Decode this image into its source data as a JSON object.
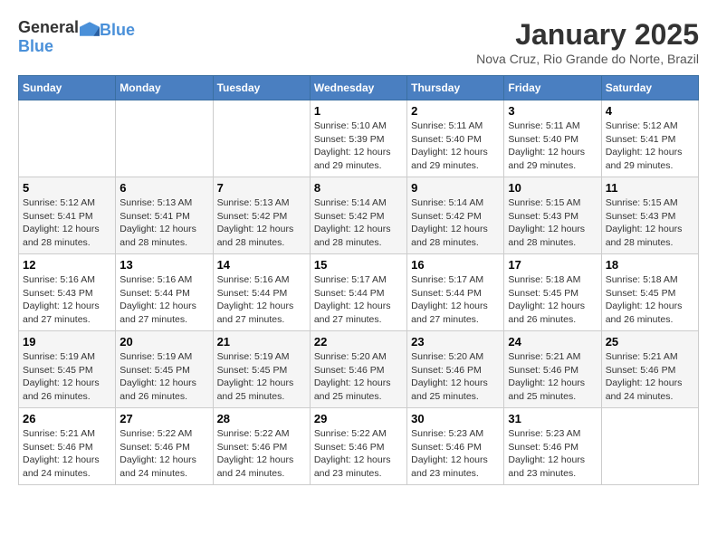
{
  "header": {
    "logo": {
      "general": "General",
      "blue": "Blue"
    },
    "title": "January 2025",
    "subtitle": "Nova Cruz, Rio Grande do Norte, Brazil"
  },
  "calendar": {
    "weekdays": [
      "Sunday",
      "Monday",
      "Tuesday",
      "Wednesday",
      "Thursday",
      "Friday",
      "Saturday"
    ],
    "weeks": [
      [
        {
          "day": "",
          "info": ""
        },
        {
          "day": "",
          "info": ""
        },
        {
          "day": "",
          "info": ""
        },
        {
          "day": "1",
          "info": "Sunrise: 5:10 AM\nSunset: 5:39 PM\nDaylight: 12 hours\nand 29 minutes."
        },
        {
          "day": "2",
          "info": "Sunrise: 5:11 AM\nSunset: 5:40 PM\nDaylight: 12 hours\nand 29 minutes."
        },
        {
          "day": "3",
          "info": "Sunrise: 5:11 AM\nSunset: 5:40 PM\nDaylight: 12 hours\nand 29 minutes."
        },
        {
          "day": "4",
          "info": "Sunrise: 5:12 AM\nSunset: 5:41 PM\nDaylight: 12 hours\nand 29 minutes."
        }
      ],
      [
        {
          "day": "5",
          "info": "Sunrise: 5:12 AM\nSunset: 5:41 PM\nDaylight: 12 hours\nand 28 minutes."
        },
        {
          "day": "6",
          "info": "Sunrise: 5:13 AM\nSunset: 5:41 PM\nDaylight: 12 hours\nand 28 minutes."
        },
        {
          "day": "7",
          "info": "Sunrise: 5:13 AM\nSunset: 5:42 PM\nDaylight: 12 hours\nand 28 minutes."
        },
        {
          "day": "8",
          "info": "Sunrise: 5:14 AM\nSunset: 5:42 PM\nDaylight: 12 hours\nand 28 minutes."
        },
        {
          "day": "9",
          "info": "Sunrise: 5:14 AM\nSunset: 5:42 PM\nDaylight: 12 hours\nand 28 minutes."
        },
        {
          "day": "10",
          "info": "Sunrise: 5:15 AM\nSunset: 5:43 PM\nDaylight: 12 hours\nand 28 minutes."
        },
        {
          "day": "11",
          "info": "Sunrise: 5:15 AM\nSunset: 5:43 PM\nDaylight: 12 hours\nand 28 minutes."
        }
      ],
      [
        {
          "day": "12",
          "info": "Sunrise: 5:16 AM\nSunset: 5:43 PM\nDaylight: 12 hours\nand 27 minutes."
        },
        {
          "day": "13",
          "info": "Sunrise: 5:16 AM\nSunset: 5:44 PM\nDaylight: 12 hours\nand 27 minutes."
        },
        {
          "day": "14",
          "info": "Sunrise: 5:16 AM\nSunset: 5:44 PM\nDaylight: 12 hours\nand 27 minutes."
        },
        {
          "day": "15",
          "info": "Sunrise: 5:17 AM\nSunset: 5:44 PM\nDaylight: 12 hours\nand 27 minutes."
        },
        {
          "day": "16",
          "info": "Sunrise: 5:17 AM\nSunset: 5:44 PM\nDaylight: 12 hours\nand 27 minutes."
        },
        {
          "day": "17",
          "info": "Sunrise: 5:18 AM\nSunset: 5:45 PM\nDaylight: 12 hours\nand 26 minutes."
        },
        {
          "day": "18",
          "info": "Sunrise: 5:18 AM\nSunset: 5:45 PM\nDaylight: 12 hours\nand 26 minutes."
        }
      ],
      [
        {
          "day": "19",
          "info": "Sunrise: 5:19 AM\nSunset: 5:45 PM\nDaylight: 12 hours\nand 26 minutes."
        },
        {
          "day": "20",
          "info": "Sunrise: 5:19 AM\nSunset: 5:45 PM\nDaylight: 12 hours\nand 26 minutes."
        },
        {
          "day": "21",
          "info": "Sunrise: 5:19 AM\nSunset: 5:45 PM\nDaylight: 12 hours\nand 25 minutes."
        },
        {
          "day": "22",
          "info": "Sunrise: 5:20 AM\nSunset: 5:46 PM\nDaylight: 12 hours\nand 25 minutes."
        },
        {
          "day": "23",
          "info": "Sunrise: 5:20 AM\nSunset: 5:46 PM\nDaylight: 12 hours\nand 25 minutes."
        },
        {
          "day": "24",
          "info": "Sunrise: 5:21 AM\nSunset: 5:46 PM\nDaylight: 12 hours\nand 25 minutes."
        },
        {
          "day": "25",
          "info": "Sunrise: 5:21 AM\nSunset: 5:46 PM\nDaylight: 12 hours\nand 24 minutes."
        }
      ],
      [
        {
          "day": "26",
          "info": "Sunrise: 5:21 AM\nSunset: 5:46 PM\nDaylight: 12 hours\nand 24 minutes."
        },
        {
          "day": "27",
          "info": "Sunrise: 5:22 AM\nSunset: 5:46 PM\nDaylight: 12 hours\nand 24 minutes."
        },
        {
          "day": "28",
          "info": "Sunrise: 5:22 AM\nSunset: 5:46 PM\nDaylight: 12 hours\nand 24 minutes."
        },
        {
          "day": "29",
          "info": "Sunrise: 5:22 AM\nSunset: 5:46 PM\nDaylight: 12 hours\nand 23 minutes."
        },
        {
          "day": "30",
          "info": "Sunrise: 5:23 AM\nSunset: 5:46 PM\nDaylight: 12 hours\nand 23 minutes."
        },
        {
          "day": "31",
          "info": "Sunrise: 5:23 AM\nSunset: 5:46 PM\nDaylight: 12 hours\nand 23 minutes."
        },
        {
          "day": "",
          "info": ""
        }
      ]
    ]
  }
}
